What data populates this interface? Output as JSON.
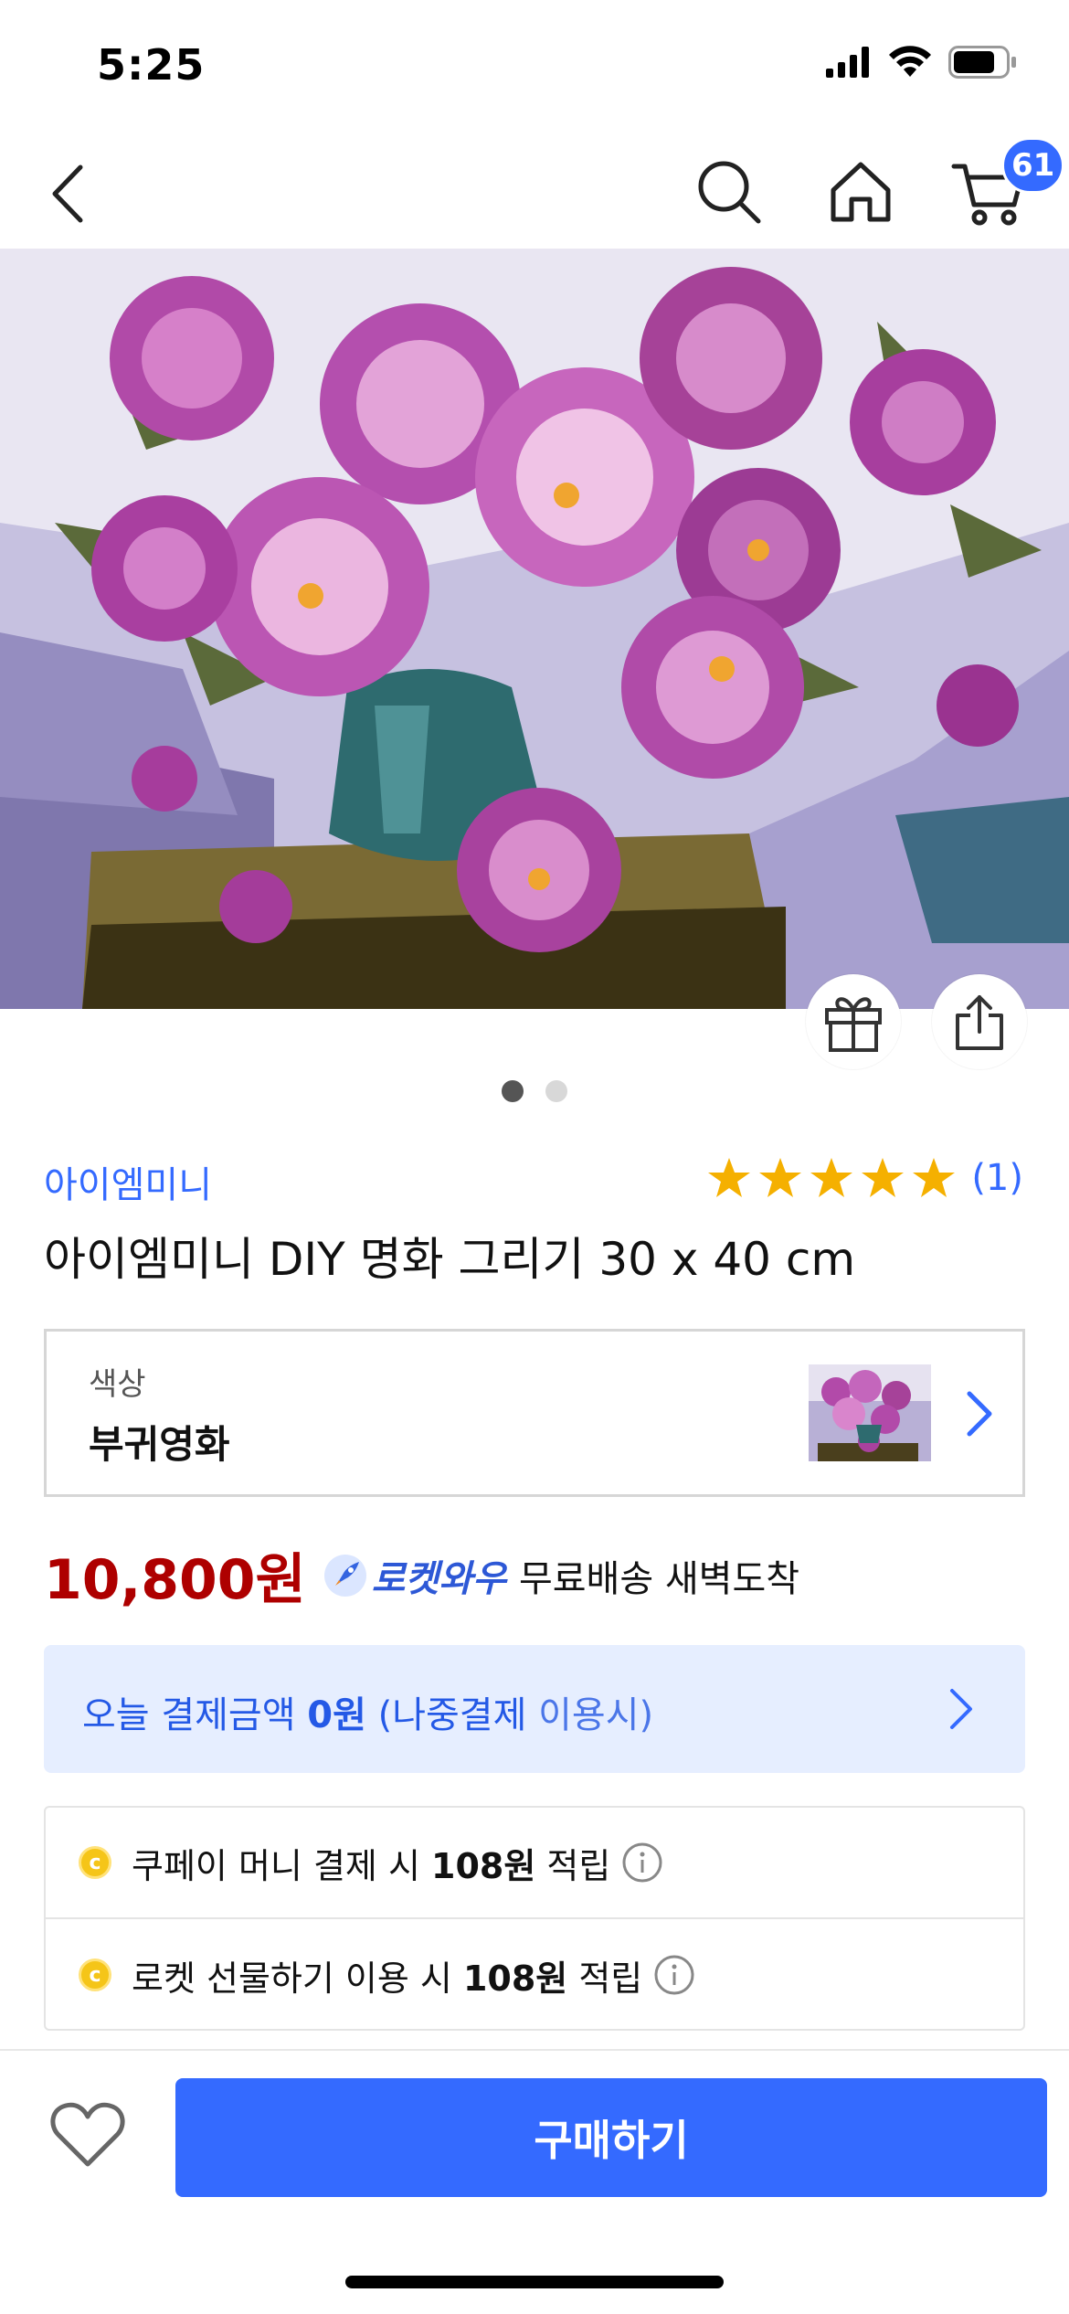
{
  "status_bar": {
    "time": "5:25",
    "icons": [
      "signal-icon",
      "wifi-icon",
      "battery-icon"
    ]
  },
  "nav": {
    "cart_count": "61",
    "icons": [
      "back-icon",
      "search-icon",
      "home-icon",
      "cart-icon"
    ]
  },
  "gallery": {
    "image_count": 2,
    "active_index": 0
  },
  "product": {
    "brand": "아이엠미니",
    "title": "아이엠미니 DIY 명화 그리기 30 x 40 cm",
    "rating_stars": 5,
    "rating_count": "(1)"
  },
  "option": {
    "label": "색상",
    "value": "부귀영화"
  },
  "price": {
    "amount": "10,800원",
    "rocket_label": "로켓와우",
    "delivery": "무료배송 새벽도착"
  },
  "paylater": {
    "part1": "오늘 결제금액 ",
    "amount": "0원",
    "part2": " (나중결제 ",
    "part3": "이용시)"
  },
  "rewards": [
    {
      "prefix": "쿠페이 머니 결제 시 ",
      "amount": "108원",
      "suffix": " 적립"
    },
    {
      "prefix": "로켓 선물하기 이용 시 ",
      "amount": "108원",
      "suffix": " 적립"
    }
  ],
  "bottom": {
    "buy_label": "구매하기"
  },
  "colors": {
    "accent": "#346aff",
    "price": "#ae0000",
    "banner_bg": "#e6eeff"
  }
}
